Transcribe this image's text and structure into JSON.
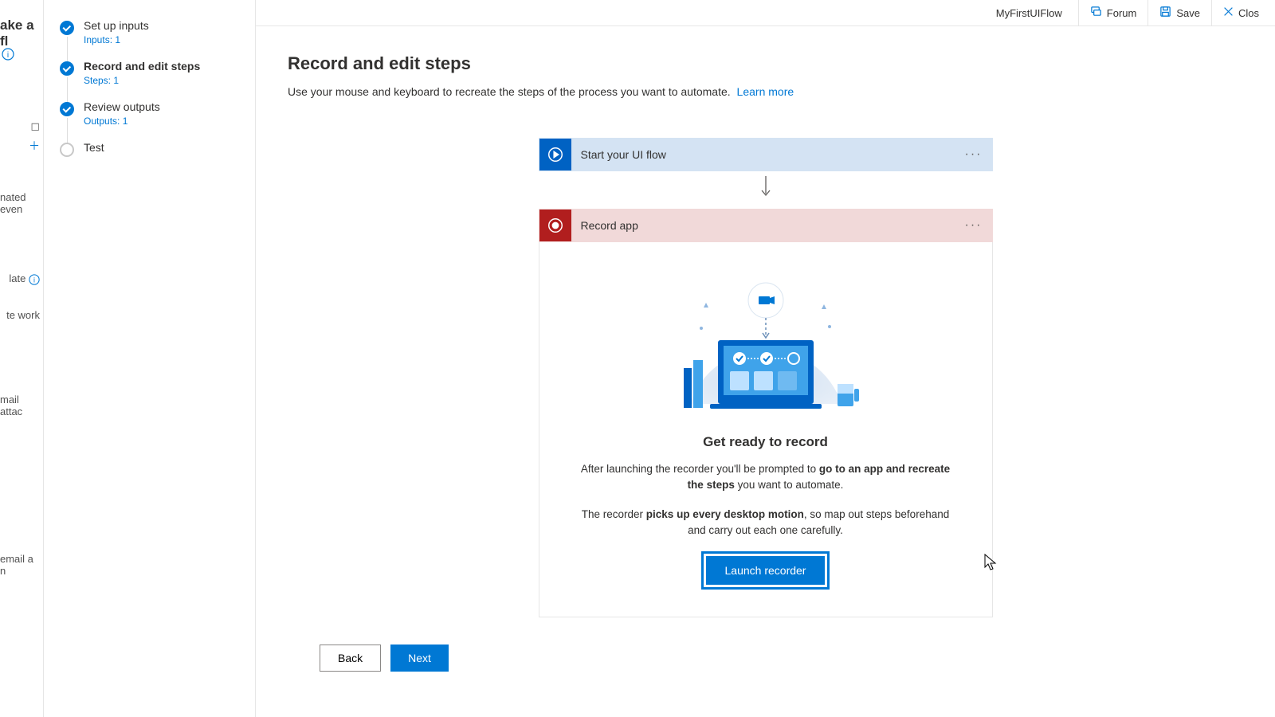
{
  "topbar": {
    "flow_name": "MyFirstUIFlow",
    "forum": "Forum",
    "save": "Save",
    "close": "Clos"
  },
  "far_left": {
    "title_fragment": "ake a fl",
    "snippets": [
      "nated even",
      "late",
      "te work",
      "mail attac",
      "email a n"
    ]
  },
  "sidebar": {
    "steps": [
      {
        "title": "Set up inputs",
        "sub": "Inputs: 1",
        "state": "done"
      },
      {
        "title": "Record and edit steps",
        "sub": "Steps: 1",
        "state": "done",
        "bold": true
      },
      {
        "title": "Review outputs",
        "sub": "Outputs: 1",
        "state": "done"
      },
      {
        "title": "Test",
        "sub": "",
        "state": "pending"
      }
    ]
  },
  "main": {
    "title": "Record and edit steps",
    "description": "Use your mouse and keyboard to recreate the steps of the process you want to automate.",
    "learn_more": "Learn more"
  },
  "cards": {
    "start": {
      "label": "Start your UI flow"
    },
    "record": {
      "label": "Record app"
    }
  },
  "record_panel": {
    "heading": "Get ready to record",
    "para1_pre": "After launching the recorder you'll be prompted to ",
    "para1_bold": "go to an app and recreate the steps",
    "para1_post": " you want to automate.",
    "para2_pre": "The recorder ",
    "para2_bold": "picks up every desktop motion",
    "para2_post": ", so map out steps beforehand and carry out each one carefully.",
    "launch_btn": "Launch recorder"
  },
  "footer": {
    "back": "Back",
    "next": "Next"
  }
}
